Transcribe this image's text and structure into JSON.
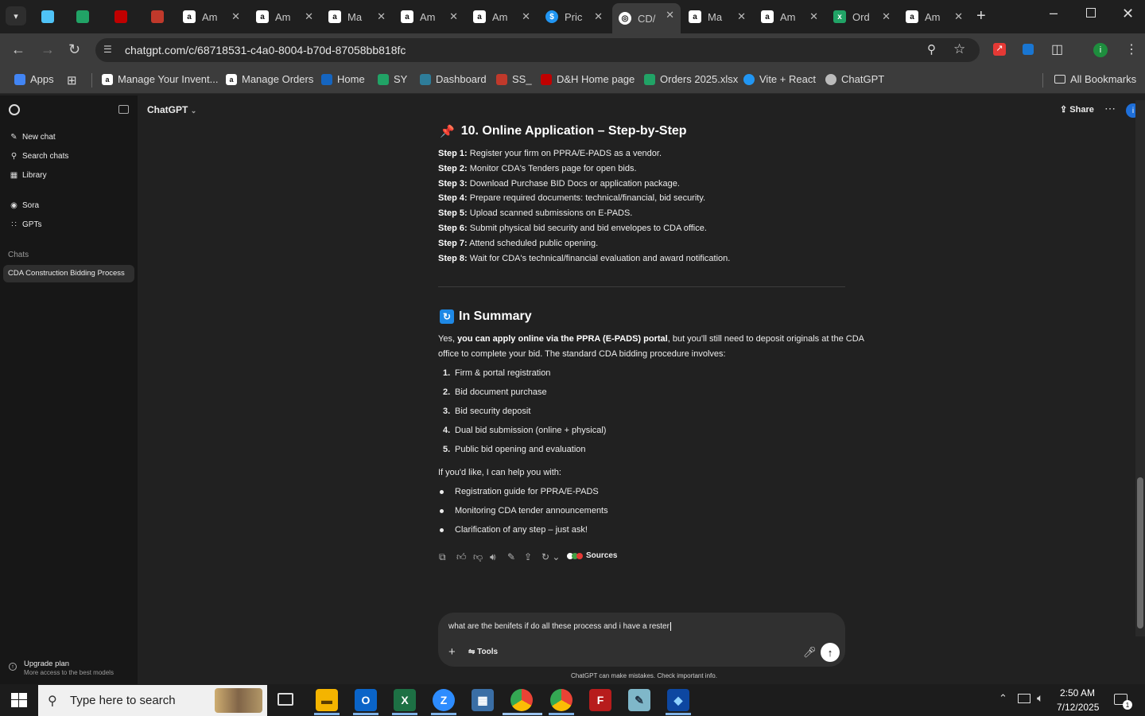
{
  "browser": {
    "tabs": [
      {
        "title": "",
        "icon": "flutter-icon",
        "color": "#4fc3f7"
      },
      {
        "title": "",
        "icon": "ec-icon",
        "color": "#21a366"
      },
      {
        "title": "",
        "icon": "dh-icon",
        "color": "#c00000"
      },
      {
        "title": "",
        "icon": "stack-icon",
        "color": "#c0392b"
      },
      {
        "title": "Am",
        "icon": "amazon-icon",
        "color": "#ffffff"
      },
      {
        "title": "Am",
        "icon": "amazon-icon",
        "color": "#ffffff"
      },
      {
        "title": "Ma",
        "icon": "amazon-icon",
        "color": "#ffffff"
      },
      {
        "title": "Am",
        "icon": "amazon-icon",
        "color": "#ffffff"
      },
      {
        "title": "Am",
        "icon": "amazon-icon",
        "color": "#ffffff"
      },
      {
        "title": "Pric",
        "icon": "dollar-icon",
        "color": "#2196f3"
      },
      {
        "title": "CD/",
        "icon": "openai-icon",
        "color": "#ffffff"
      },
      {
        "title": "Ma",
        "icon": "amazon-icon",
        "color": "#ffffff"
      },
      {
        "title": "Am",
        "icon": "amazon-icon",
        "color": "#ffffff"
      },
      {
        "title": "Ord",
        "icon": "excel-icon",
        "color": "#21a366"
      },
      {
        "title": "Am",
        "icon": "amazon-icon",
        "color": "#ffffff"
      }
    ],
    "url": "chatgpt.com/c/68718531-c4a0-8004-b70d-87058bb818fc",
    "bookmarks": [
      "Apps",
      "Manage Your Invent...",
      "Manage Orders",
      "Home",
      "SY",
      "Dashboard",
      "SS_",
      "D&H Home page",
      "Orders 2025.xlsx",
      "Vite + React",
      "ChatGPT"
    ],
    "all_bookmarks": "All Bookmarks",
    "profile_initial": "i"
  },
  "sidebar": {
    "new_chat": "New chat",
    "search_chats": "Search chats",
    "library": "Library",
    "sora": "Sora",
    "gpts": "GPTs",
    "chats_heading": "Chats",
    "active_chat": "CDA Construction Bidding Process",
    "upgrade_title": "Upgrade plan",
    "upgrade_sub": "More access to the best models"
  },
  "header": {
    "model": "ChatGPT",
    "share": "Share",
    "profile_initial": "i"
  },
  "content": {
    "section10_title": "10. Online Application – Step-by-Step",
    "steps": [
      {
        "label": "Step 1:",
        "text": " Register your firm on PPRA/E-PADS as a vendor."
      },
      {
        "label": "Step 2:",
        "text": " Monitor CDA's Tenders page for open bids."
      },
      {
        "label": "Step 3:",
        "text": " Download Purchase BID Docs or application package."
      },
      {
        "label": "Step 4:",
        "text": " Prepare required documents: technical/financial, bid security."
      },
      {
        "label": "Step 5:",
        "text": " Upload scanned submissions on E-PADS."
      },
      {
        "label": "Step 6:",
        "text": " Submit physical bid security and bid envelopes to CDA office."
      },
      {
        "label": "Step 7:",
        "text": " Attend scheduled public opening."
      },
      {
        "label": "Step 8:",
        "text": " Wait for CDA's technical/financial evaluation and award notification."
      }
    ],
    "summary_title": "In Summary",
    "summary_p1_a": "Yes, ",
    "summary_p1_bold": "you can apply online via the PPRA (E-PADS) portal",
    "summary_p1_b": ", but you'll still need to deposit originals at the CDA",
    "summary_p1_line2": "office to complete your bid. The standard CDA bidding procedure involves:",
    "numbered": [
      "Firm & portal registration",
      "Bid document purchase",
      "Bid security deposit",
      "Dual bid submission (online + physical)",
      "Public bid opening and evaluation"
    ],
    "help_intro": "If you'd like, I can help you with:",
    "bullets": [
      "Registration guide for PPRA/E-PADS",
      "Monitoring CDA tender announcements",
      "Clarification of any step – just ask!"
    ],
    "sources_label": "Sources"
  },
  "composer": {
    "typed_text": "what are the benifets if do all these process and i have a rester",
    "tools_label": "Tools",
    "disclaimer": "ChatGPT can make mistakes. Check important info."
  },
  "taskbar": {
    "search_placeholder": "Type here to search",
    "time": "2:50 AM",
    "date": "7/12/2025",
    "notification_count": "1"
  }
}
